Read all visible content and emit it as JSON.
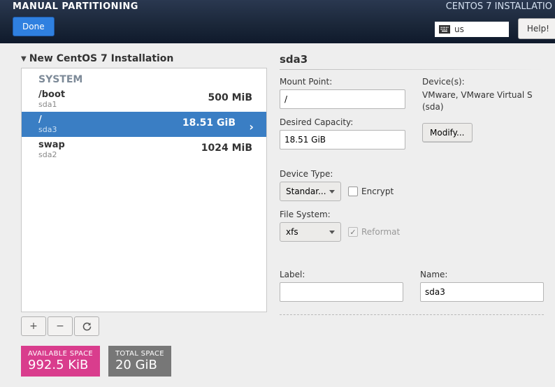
{
  "header": {
    "title": "MANUAL PARTITIONING",
    "subtitle": "CENTOS 7 INSTALLATIO",
    "done_label": "Done",
    "keyboard_layout": "us",
    "help_label": "Help!"
  },
  "installation_expand_label": "New CentOS 7 Installation",
  "group_label": "SYSTEM",
  "partitions": [
    {
      "mount": "/boot",
      "device": "sda1",
      "size": "500 MiB",
      "selected": false
    },
    {
      "mount": "/",
      "device": "sda3",
      "size": "18.51 GiB",
      "selected": true
    },
    {
      "mount": "swap",
      "device": "sda2",
      "size": "1024 MiB",
      "selected": false
    }
  ],
  "toolbar": {
    "add_label": "+",
    "remove_label": "−"
  },
  "space": {
    "available_label": "AVAILABLE SPACE",
    "available_value": "992.5 KiB",
    "total_label": "TOTAL SPACE",
    "total_value": "20 GiB"
  },
  "details": {
    "heading": "sda3",
    "mount_point_label": "Mount Point:",
    "mount_point_value": "/",
    "desired_capacity_label": "Desired Capacity:",
    "desired_capacity_value": "18.51 GiB",
    "devices_label": "Device(s):",
    "device_info": "VMware, VMware Virtual S (sda)",
    "modify_label": "Modify...",
    "device_type_label": "Device Type:",
    "device_type_value": "Standar...",
    "encrypt_label": "Encrypt",
    "file_system_label": "File System:",
    "file_system_value": "xfs",
    "reformat_label": "Reformat",
    "label_label": "Label:",
    "label_value": "",
    "name_label": "Name:",
    "name_value": "sda3"
  }
}
